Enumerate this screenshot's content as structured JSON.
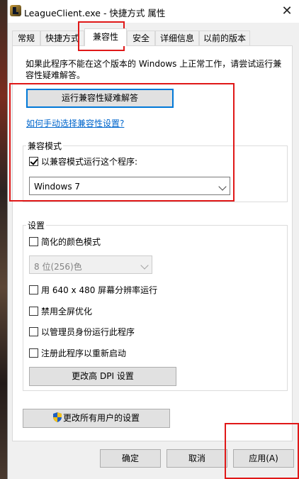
{
  "window": {
    "title": "LeagueClient.exe - 快捷方式 属性",
    "close_glyph": "✕"
  },
  "tabs": [
    {
      "label": "常规"
    },
    {
      "label": "快捷方式"
    },
    {
      "label": "兼容性"
    },
    {
      "label": "安全"
    },
    {
      "label": "详细信息"
    },
    {
      "label": "以前的版本"
    }
  ],
  "active_tab": "兼容性",
  "intro_text": "如果此程序不能在这个版本的 Windows 上正常工作，请尝试运行兼容性疑难解答。",
  "troubleshooter_button": "运行兼容性疑难解答",
  "manual_link": "如何手动选择兼容性设置?",
  "compat_group": {
    "label": "兼容模式",
    "checkbox_label": "以兼容模式运行这个程序:",
    "checked": true,
    "os_select_value": "Windows 7"
  },
  "settings_group": {
    "label": "设置",
    "reduced_color": {
      "label": "简化的颜色模式",
      "checked": false
    },
    "color_select_value": "8 位(256)色",
    "run_640": {
      "label": "用 640 x 480 屏幕分辨率运行",
      "checked": false
    },
    "disable_fullscreen_opt": {
      "label": "禁用全屏优化",
      "checked": false
    },
    "run_as_admin": {
      "label": "以管理员身份运行此程序",
      "checked": false
    },
    "register_restart": {
      "label": "注册此程序以重新启动",
      "checked": false
    },
    "dpi_button": "更改高 DPI 设置"
  },
  "all_users_button": "更改所有用户的设置",
  "footer": {
    "ok": "确定",
    "cancel": "取消",
    "apply": "应用(A)"
  },
  "colors": {
    "highlight_red": "#e01818",
    "link_blue": "#0066cc",
    "focus_blue": "#0078d7"
  }
}
